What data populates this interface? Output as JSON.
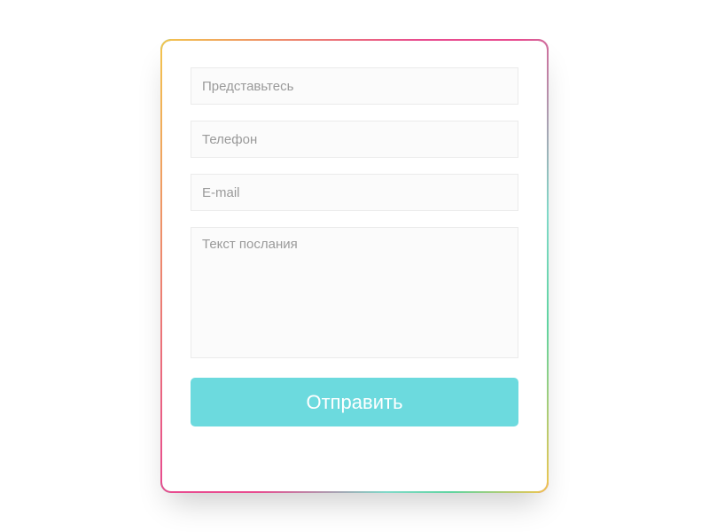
{
  "form": {
    "name": {
      "placeholder": "Представьтесь",
      "value": ""
    },
    "phone": {
      "placeholder": "Телефон",
      "value": ""
    },
    "email": {
      "placeholder": "E-mail",
      "value": ""
    },
    "message": {
      "placeholder": "Текст послания",
      "value": ""
    },
    "submit_label": "Отправить"
  },
  "colors": {
    "button_bg": "#6cdade",
    "button_text": "#ffffff",
    "input_bg": "#fbfbfb",
    "input_border": "#ebebeb",
    "placeholder": "#9a9a9a"
  }
}
